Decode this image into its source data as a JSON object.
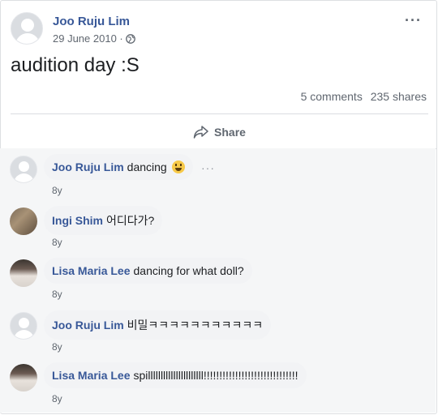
{
  "post": {
    "author": "Joo Ruju Lim",
    "date": "29 June 2010 ·",
    "text": "audition day :S",
    "comments_count": "5 comments",
    "shares_count": "235 shares",
    "share_label": "Share",
    "more": "···"
  },
  "comments": [
    {
      "name": "Joo Ruju Lim",
      "text": "dancing",
      "age": "8y",
      "avatar": "default-avatar",
      "emoji": "grinning-emoji"
    },
    {
      "name": "Ingi Shim",
      "text": "어디다가?",
      "age": "8y",
      "avatar": "cat-photo"
    },
    {
      "name": "Lisa Maria Lee",
      "text": "dancing for what doll?",
      "age": "8y",
      "avatar": "profile-photo"
    },
    {
      "name": "Joo Ruju Lim",
      "text": "비밀ㅋㅋㅋㅋㅋㅋㅋㅋㅋㅋㅋ",
      "age": "8y",
      "avatar": "default-avatar"
    },
    {
      "name": "Lisa Maria Lee",
      "text": "spillllllllllllllllllllll!!!!!!!!!!!!!!!!!!!!!!!!!!!!!!",
      "age": "8y",
      "avatar": "profile-photo"
    }
  ],
  "comment_more": "···",
  "colors": {
    "link": "#385898",
    "muted": "#606770",
    "bubble": "#f2f3f5"
  }
}
